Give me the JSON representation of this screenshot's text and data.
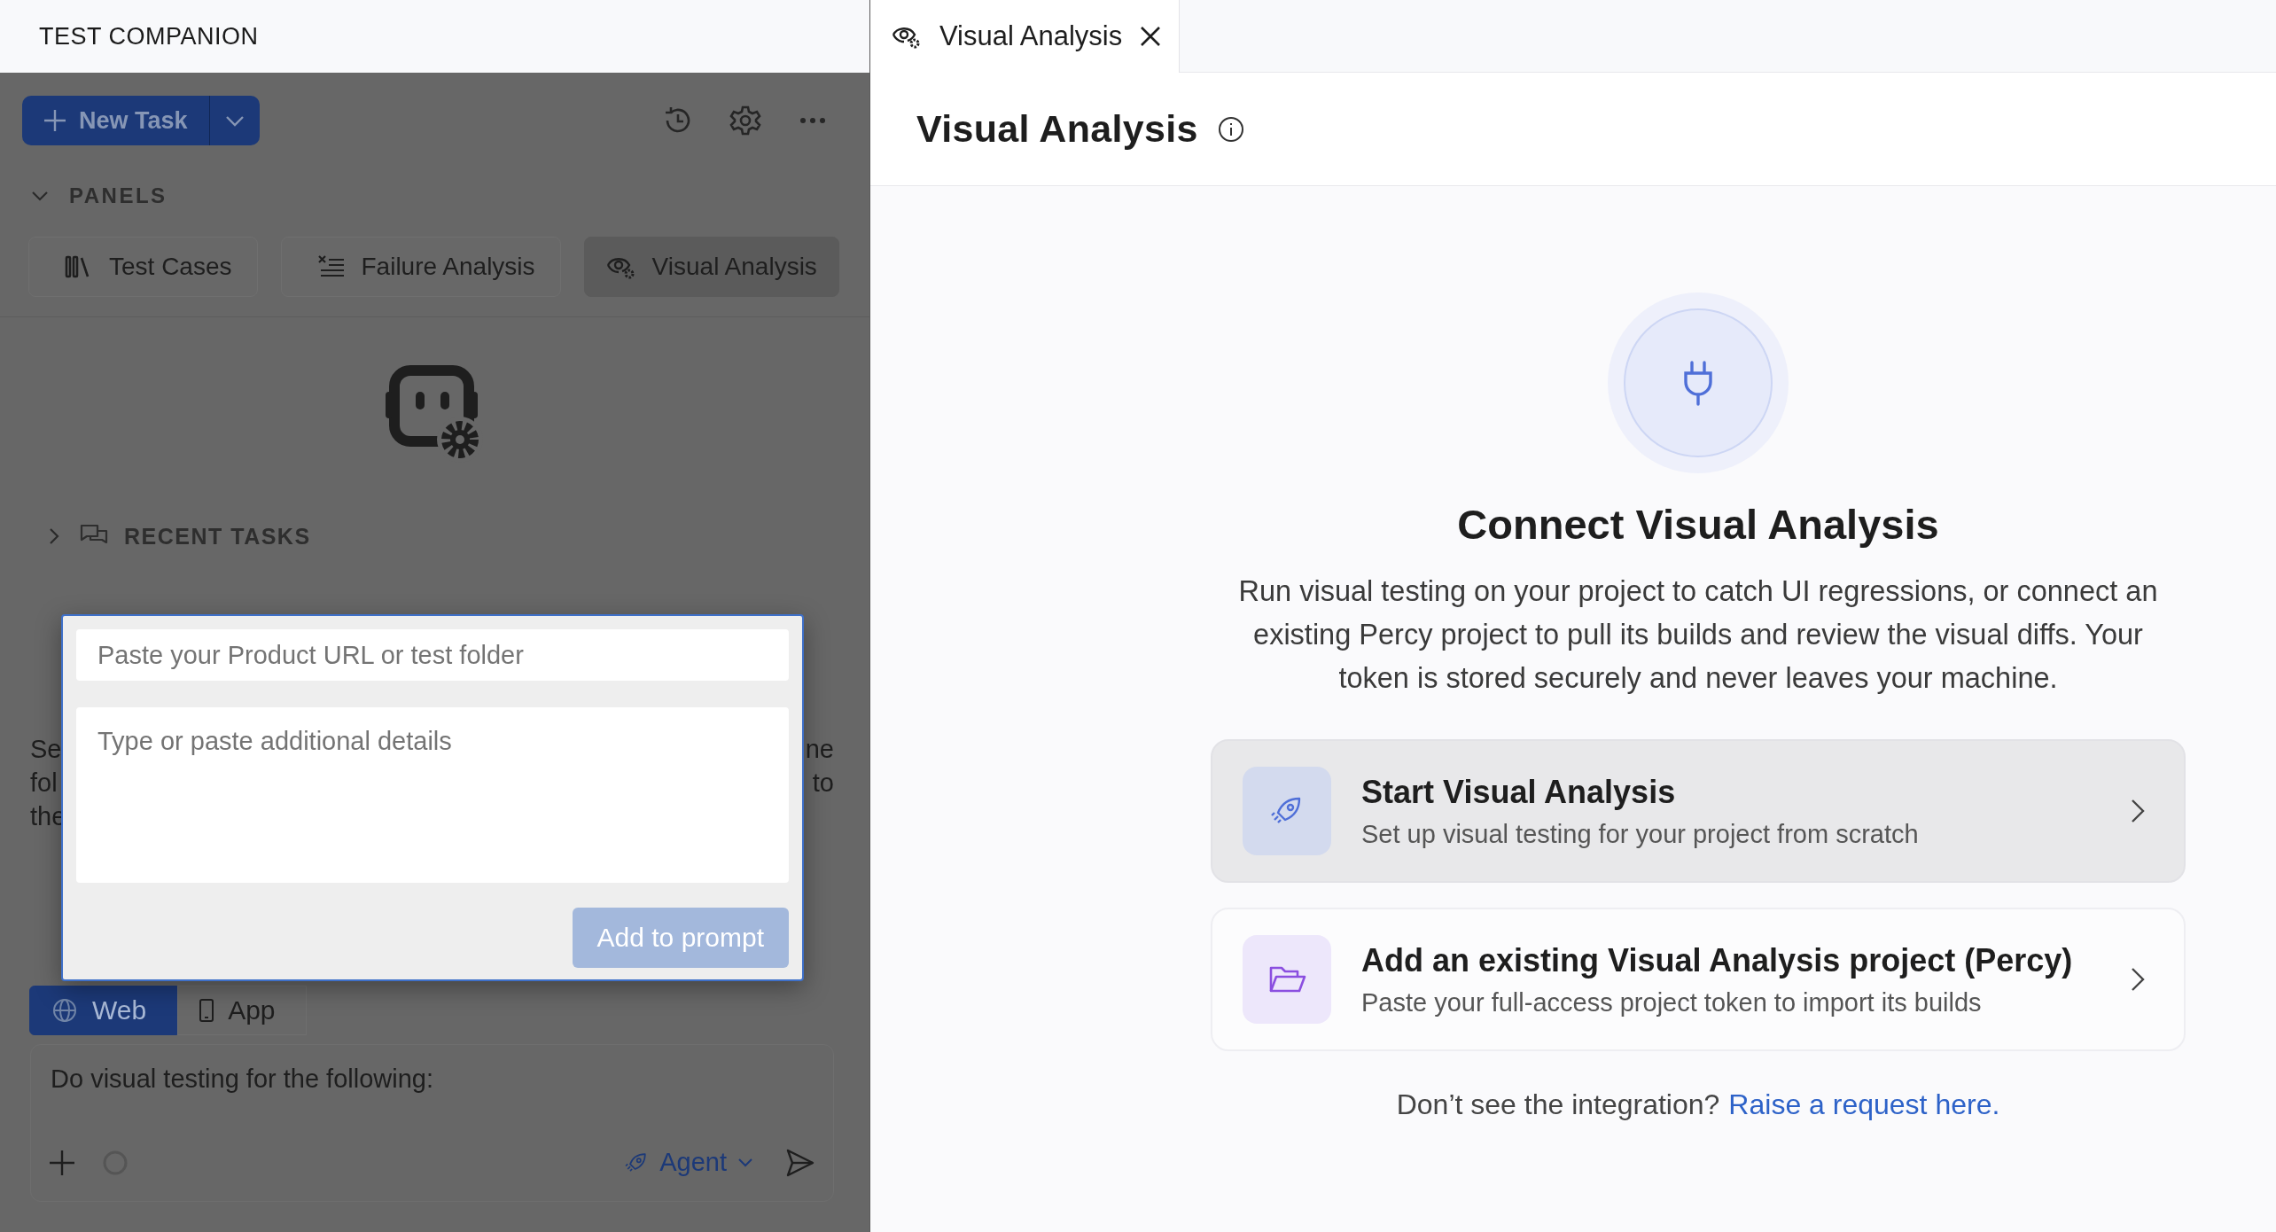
{
  "sidebar": {
    "title": "TEST COMPANION",
    "new_task": {
      "label": "New Task"
    },
    "panels": {
      "heading": "PANELS",
      "expanded": true,
      "tabs": [
        {
          "label": "Test Cases",
          "kind": "cases",
          "selected": false
        },
        {
          "label": "Failure Analysis",
          "kind": "failure",
          "selected": false
        },
        {
          "label": "Visual Analysis",
          "kind": "visual",
          "selected": true
        }
      ]
    },
    "recent_tasks": {
      "heading": "RECENT TASKS",
      "expanded": false
    },
    "hidden_text": {
      "left": [
        "Se",
        "fol",
        "the"
      ],
      "right": [
        "ne",
        "to"
      ]
    },
    "mode_tabs": [
      {
        "label": "Web",
        "kind": "web",
        "selected": true
      },
      {
        "label": "App",
        "kind": "app",
        "selected": false
      }
    ],
    "composer": {
      "value": "Do visual testing for the following:",
      "mode": "Agent"
    }
  },
  "popup": {
    "url_field": {
      "placeholder": "Paste your Product URL or test folder"
    },
    "details_field": {
      "placeholder": "Type or paste additional details"
    },
    "submit": {
      "label": "Add to prompt",
      "disabled": true
    }
  },
  "main": {
    "tab": {
      "label": "Visual Analysis"
    },
    "heading": "Visual Analysis",
    "connect": {
      "title": "Connect Visual Analysis",
      "description": "Run visual testing on your project to catch UI regressions, or connect an existing Percy project to pull its builds and review the visual diffs. Your token is stored securely and never leaves your machine.",
      "options": [
        {
          "kind": "start",
          "title": "Start Visual Analysis",
          "subtitle": "Set up visual testing for your project from scratch",
          "selected": true
        },
        {
          "kind": "existing",
          "title": "Add an existing Visual Analysis project (Percy)",
          "subtitle": "Paste your full-access project token to import its builds",
          "selected": false
        }
      ],
      "footer": {
        "text": "Don’t see the integration?",
        "link": "Raise a request here."
      }
    }
  }
}
